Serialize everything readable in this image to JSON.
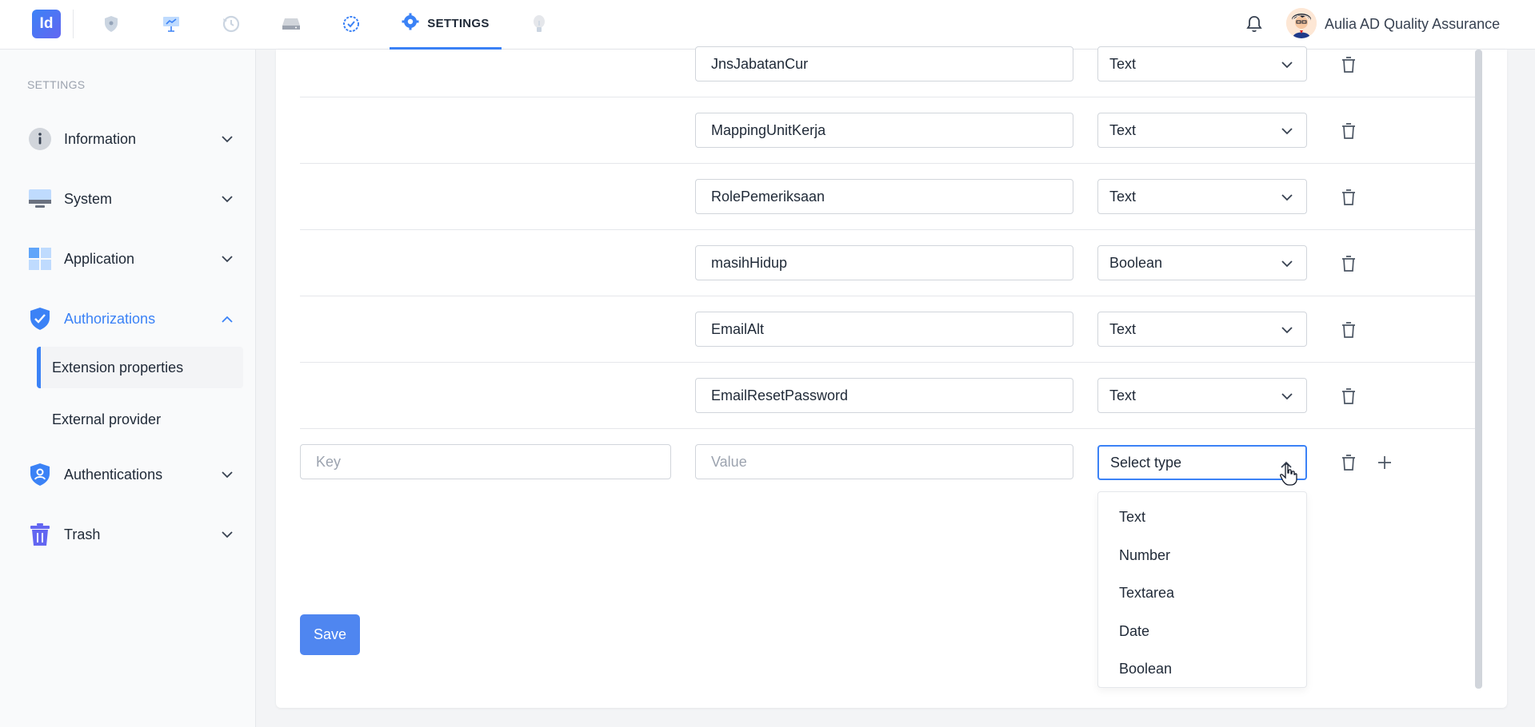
{
  "app": {
    "logo_text": "Id",
    "nav": [
      {
        "icon": "shield-icon"
      },
      {
        "icon": "presentation-icon"
      },
      {
        "icon": "history-icon"
      },
      {
        "icon": "drive-icon"
      },
      {
        "icon": "check-badge-icon"
      },
      {
        "icon": "gear-icon",
        "label": "SETTINGS",
        "active": true
      },
      {
        "icon": "lightbulb-icon"
      }
    ],
    "user": {
      "name": "Aulia AD Quality Assurance"
    }
  },
  "sidebar": {
    "heading": "SETTINGS",
    "items": [
      {
        "label": "Information",
        "icon": "info-icon",
        "expanded": false
      },
      {
        "label": "System",
        "icon": "monitor-icon",
        "expanded": false
      },
      {
        "label": "Application",
        "icon": "apps-grid-icon",
        "expanded": false
      },
      {
        "label": "Authorizations",
        "icon": "shield-check-icon",
        "expanded": true,
        "active": true
      },
      {
        "label": "Authentications",
        "icon": "shield-user-icon",
        "expanded": false
      },
      {
        "label": "Trash",
        "icon": "trash-icon",
        "expanded": false
      }
    ],
    "sub_items": [
      {
        "label": "Extension properties",
        "active": true
      },
      {
        "label": "External provider",
        "active": false
      }
    ]
  },
  "rows": [
    {
      "value": "JnsJabatanCur",
      "type": "Text"
    },
    {
      "value": "MappingUnitKerja",
      "type": "Text"
    },
    {
      "value": "RolePemeriksaan",
      "type": "Text"
    },
    {
      "value": "masihHidup",
      "type": "Boolean"
    },
    {
      "value": "EmailAlt",
      "type": "Text"
    },
    {
      "value": "EmailResetPassword",
      "type": "Text"
    }
  ],
  "new_row": {
    "key_placeholder": "Key",
    "value_placeholder": "Value",
    "type_placeholder": "Select type"
  },
  "type_options": [
    "Text",
    "Number",
    "Textarea",
    "Date",
    "Boolean"
  ],
  "save_label": "Save",
  "colors": {
    "accent": "#3b82f6",
    "button": "#4f86f0"
  }
}
